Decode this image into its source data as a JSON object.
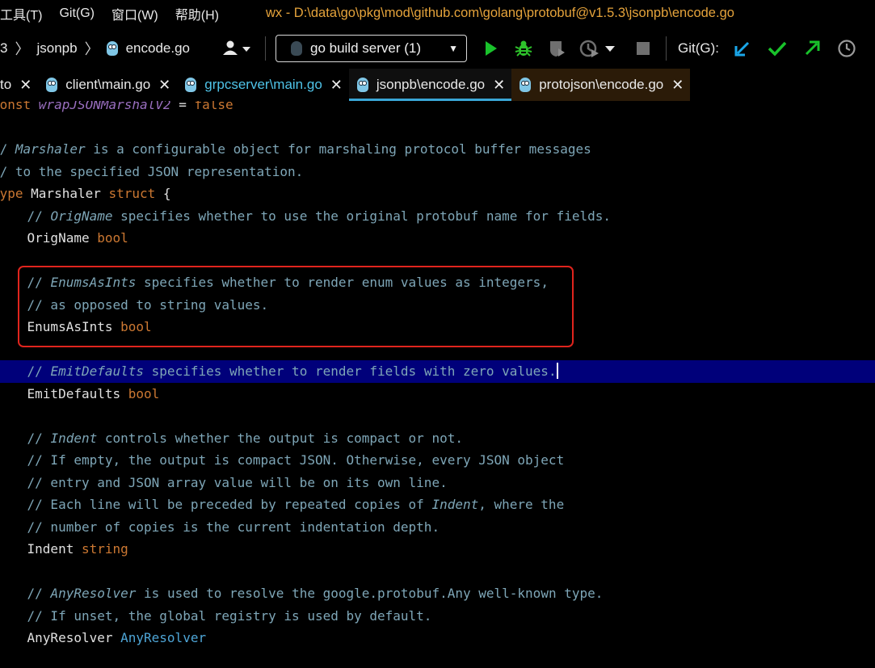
{
  "menu": {
    "items": [
      "工具(T)",
      "Git(G)",
      "窗口(W)",
      "帮助(H)"
    ],
    "window_title": "wx - D:\\data\\go\\pkg\\mod\\github.com\\golang\\protobuf@v1.5.3\\jsonpb\\encode.go"
  },
  "navbar": {
    "breadcrumb": [
      "3",
      "jsonpb",
      "encode.go"
    ],
    "run_config": "go build server (1)",
    "git_label": "Git(G):",
    "colors": {
      "run": "#19c22b",
      "debug": "#2ec22b",
      "vcs_update": "#1aa7ea",
      "vcs_commit": "#19c22b",
      "vcs_push": "#19c22b"
    }
  },
  "tabs": [
    {
      "label": "to",
      "active": false,
      "modified": false
    },
    {
      "label": "client\\main.go",
      "active": false,
      "modified": false
    },
    {
      "label": "grpcserver\\main.go",
      "active": false,
      "modified": true
    },
    {
      "label": "jsonpb\\encode.go",
      "active": true,
      "modified": false
    },
    {
      "label": "protojson\\encode.go",
      "active": false,
      "modified": false
    }
  ],
  "code": {
    "l0": {
      "a": "const ",
      "b": "wrapJSONMarshalV2",
      "c": " = ",
      "d": "false"
    },
    "l2": {
      "a": "// ",
      "b": "Marshaler",
      "c": " is a configurable object for marshaling protocol buffer messages"
    },
    "l3": {
      "a": "// to the specified JSON representation."
    },
    "l4": {
      "a": "type",
      "b": " Marshaler ",
      "c": "struct",
      "d": " {"
    },
    "l5": {
      "a": "    // ",
      "b": "OrigName",
      "c": " specifies whether to use the original protobuf name for fields."
    },
    "l6": {
      "a": "    OrigName ",
      "b": "bool"
    },
    "l8": {
      "a": "    // ",
      "b": "EnumsAsInts",
      "c": " specifies whether to render enum values as integers,"
    },
    "l9": {
      "a": "    // as opposed to string values."
    },
    "l10": {
      "a": "    EnumsAsInts ",
      "b": "bool"
    },
    "l12": {
      "a": "    // ",
      "b": "EmitDefaults",
      "c": " specifies whether to render fields with zero values."
    },
    "l13": {
      "a": "    EmitDefaults ",
      "b": "bool"
    },
    "l15": {
      "a": "    // ",
      "b": "Indent",
      "c": " controls whether the output is compact or not."
    },
    "l16": {
      "a": "    // If empty, the output is compact JSON. Otherwise, every JSON object"
    },
    "l17": {
      "a": "    // entry and JSON array value will be on its own line."
    },
    "l18": {
      "a": "    // Each line will be preceded by repeated copies of ",
      "b": "Indent",
      "c": ", where the"
    },
    "l19": {
      "a": "    // number of copies is the current indentation depth."
    },
    "l20": {
      "a": "    Indent ",
      "b": "string"
    },
    "l22": {
      "a": "    // ",
      "b": "AnyResolver",
      "c": " is used to resolve the google.protobuf.Any well-known type."
    },
    "l23": {
      "a": "    // If unset, the global registry is used by default."
    },
    "l24": {
      "a": "    AnyResolver ",
      "b": "AnyResolver"
    }
  }
}
